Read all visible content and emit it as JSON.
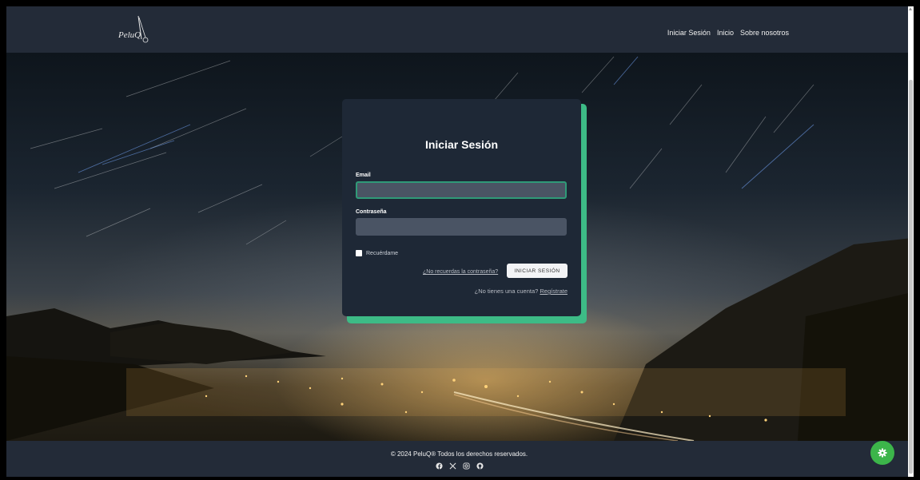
{
  "brand": {
    "logo_text": "PeluQ"
  },
  "nav": {
    "items": [
      "Iniciar Sesión",
      "Inicio",
      "Sobre nosotros"
    ]
  },
  "login": {
    "title": "Iniciar Sesión",
    "email_label": "Email",
    "email_value": "",
    "password_label": "Contraseña",
    "password_value": "",
    "remember_label": "Recuérdame",
    "forgot_link": "¿No recuerdas la contraseña?",
    "submit_label": "INICIAR SESIÓN",
    "signup_prompt": "¿No tienes una cuenta?",
    "signup_link": "Regístrate"
  },
  "footer": {
    "copyright": "© 2024 PeluQ® Todos los derechos reservados.",
    "social_icons": [
      "facebook-icon",
      "x-icon",
      "instagram-icon",
      "github-icon"
    ]
  },
  "settings_fab": {
    "icon": "gear-icon"
  },
  "colors": {
    "header_bg": "#232b38",
    "card_bg": "#1e2836",
    "accent": "#3dbb86",
    "fab": "#3cb54a"
  }
}
